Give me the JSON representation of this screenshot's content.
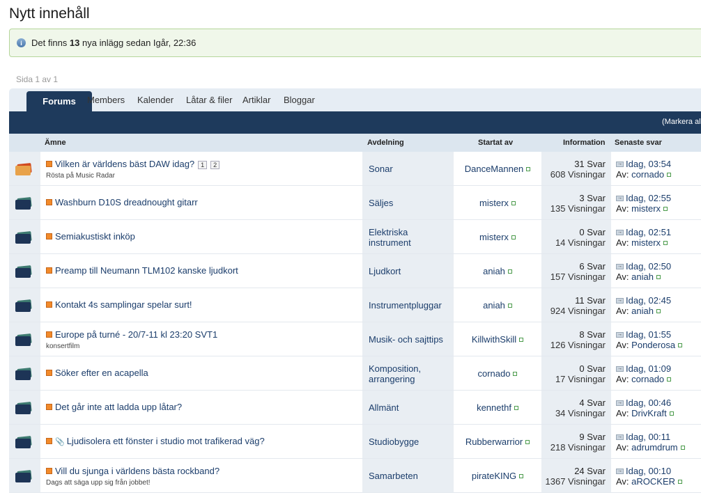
{
  "page": {
    "title": "Nytt innehåll"
  },
  "notice": {
    "pre": "Det finns ",
    "count": "13",
    "post": " nya inlägg sedan Igår, 22:36"
  },
  "pagination": {
    "label": "Sida 1 av 1"
  },
  "tabs": {
    "active": "Forums",
    "others": [
      "Members",
      "Kalender",
      "Låtar & filer",
      "Artiklar",
      "Bloggar"
    ]
  },
  "toolbar": {
    "mark_label": "(Markera all"
  },
  "columns": {
    "subject": "Ämne",
    "department": "Avdelning",
    "started_by": "Startat av",
    "information": "Information",
    "last_reply": "Senaste svar"
  },
  "rows": [
    {
      "title": "Vilken är världens bäst DAW idag?",
      "subtitle": "Rösta på Music Radar",
      "pages": [
        "1",
        "2"
      ],
      "department": [
        "Sonar"
      ],
      "starter": "DanceMannen",
      "replies": "31 Svar",
      "views": "608 Visningar",
      "last_time": "Idag, 03:54",
      "last_by_prefix": "Av: ",
      "last_by": "cornado",
      "hot": true
    },
    {
      "title": "Washburn D10S dreadnought gitarr",
      "subtitle": "",
      "department": [
        "Säljes"
      ],
      "starter": "misterx",
      "replies": "3 Svar",
      "views": "135 Visningar",
      "last_time": "Idag, 02:55",
      "last_by_prefix": "Av: ",
      "last_by": "misterx"
    },
    {
      "title": "Semiakustiskt inköp",
      "subtitle": "",
      "department": [
        "Elektriska",
        "instrument"
      ],
      "starter": "misterx",
      "replies": "0 Svar",
      "views": "14 Visningar",
      "last_time": "Idag, 02:51",
      "last_by_prefix": "Av: ",
      "last_by": "misterx"
    },
    {
      "title": "Preamp till Neumann TLM102 kanske ljudkort",
      "subtitle": "",
      "department": [
        "Ljudkort"
      ],
      "starter": "aniah",
      "replies": "6 Svar",
      "views": "157 Visningar",
      "last_time": "Idag, 02:50",
      "last_by_prefix": "Av: ",
      "last_by": "aniah"
    },
    {
      "title": "Kontakt 4s samplingar spelar surt!",
      "subtitle": "",
      "department": [
        "Instrumentpluggar"
      ],
      "starter": "aniah",
      "replies": "11 Svar",
      "views": "924 Visningar",
      "last_time": "Idag, 02:45",
      "last_by_prefix": "Av: ",
      "last_by": "aniah"
    },
    {
      "title": "Europe på turné - 20/7-11 kl 23:20 SVT1",
      "subtitle": "konsertfilm",
      "department": [
        "Musik- och sajttips"
      ],
      "starter": "KillwithSkill",
      "replies": "8 Svar",
      "views": "126 Visningar",
      "last_time": "Idag, 01:55",
      "last_by_prefix": "Av: ",
      "last_by": "Ponderosa"
    },
    {
      "title": "Söker efter en acapella",
      "subtitle": "",
      "department": [
        "Komposition,",
        "arrangering"
      ],
      "starter": "cornado",
      "replies": "0 Svar",
      "views": "17 Visningar",
      "last_time": "Idag, 01:09",
      "last_by_prefix": "Av: ",
      "last_by": "cornado"
    },
    {
      "title": "Det går inte att ladda upp låtar?",
      "subtitle": "",
      "department": [
        "Allmänt"
      ],
      "starter": "kennethf",
      "replies": "4 Svar",
      "views": "34 Visningar",
      "last_time": "Idag, 00:46",
      "last_by_prefix": "Av: ",
      "last_by": "DrivKraft"
    },
    {
      "title": "Ljudisolera ett fönster i studio mot trafikerad väg?",
      "subtitle": "",
      "attachment": true,
      "department": [
        "Studiobygge"
      ],
      "starter": "Rubberwarrior",
      "replies": "9 Svar",
      "views": "218 Visningar",
      "last_time": "Idag, 00:11",
      "last_by_prefix": "Av: ",
      "last_by": "adrumdrum"
    },
    {
      "title": "Vill du sjunga i världens bästa rockband?",
      "subtitle": "Dags att säga upp sig från jobbet!",
      "department": [
        "Samarbeten"
      ],
      "starter": "pirateKING",
      "replies": "24 Svar",
      "views": "1367 Visningar",
      "last_time": "Idag, 00:10",
      "last_by_prefix": "Av: ",
      "last_by": "aROCKER"
    }
  ]
}
